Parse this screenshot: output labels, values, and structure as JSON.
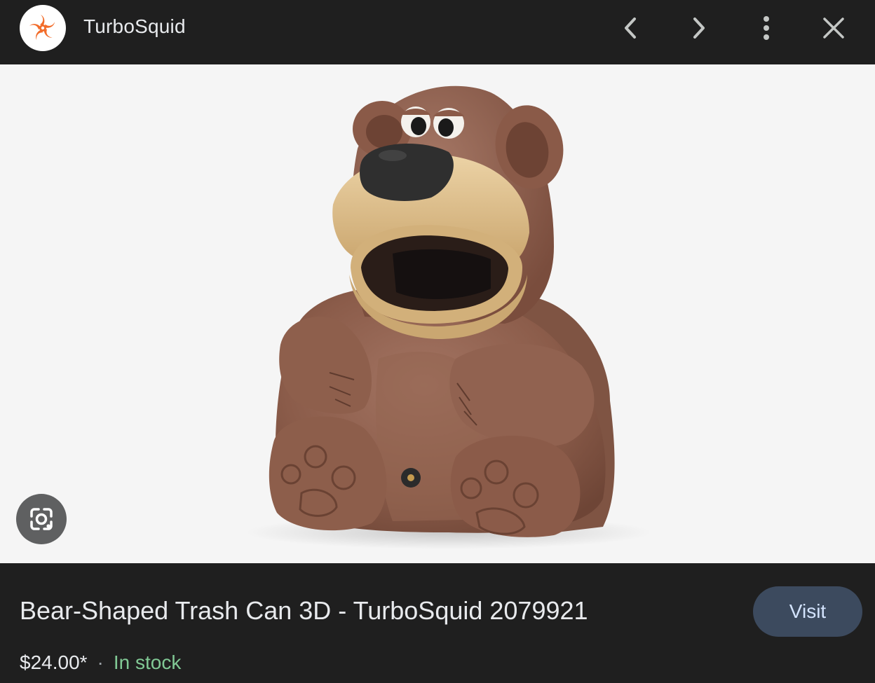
{
  "header": {
    "site_name": "TurboSquid",
    "logo_icon": "turbosquid-logo-icon",
    "prev_icon": "chevron-left-icon",
    "next_icon": "chevron-right-icon",
    "menu_icon": "more-vert-icon",
    "close_icon": "close-icon"
  },
  "image": {
    "subject": "bear-shaped-trash-can-render"
  },
  "lens": {
    "icon": "google-lens-icon"
  },
  "product": {
    "title": "Bear-Shaped Trash Can 3D - TurboSquid 2079921",
    "price": "$24.00*",
    "separator": "·",
    "availability": "In stock",
    "visit_label": "Visit"
  },
  "colors": {
    "background": "#1f1f1f",
    "image_bg": "#f5f5f5",
    "in_stock": "#81c995",
    "visit_bg": "#3c4a5e",
    "logo_orange": "#f26c2a"
  }
}
